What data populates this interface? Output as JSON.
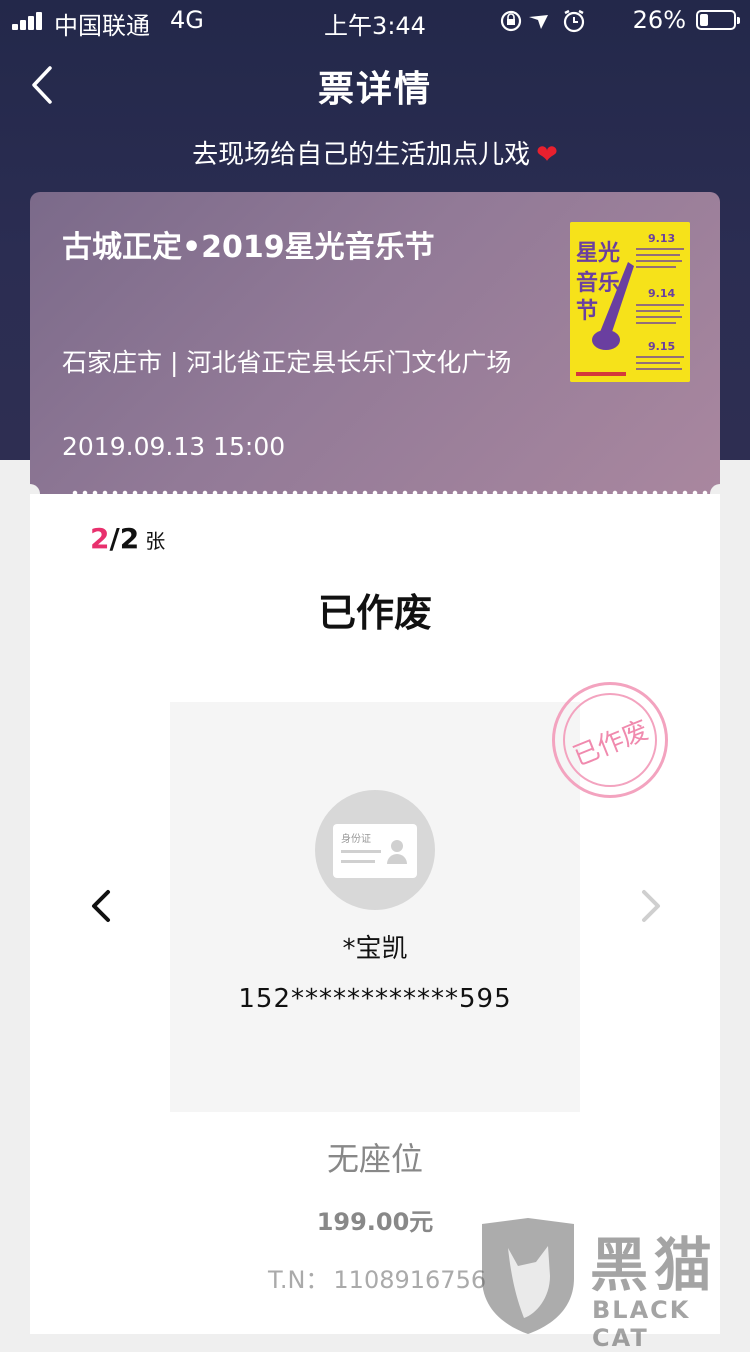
{
  "status_bar": {
    "carrier": "中国联通",
    "network": "4G",
    "time": "上午3:44",
    "battery_percent": "26%",
    "battery_level": 0.26
  },
  "header": {
    "title": "票详情",
    "slogan": "去现场给自己的生活加点儿戏",
    "slogan_icon": "heart-icon",
    "heart_symbol": "❤"
  },
  "event": {
    "title": "古城正定•2019星光音乐节",
    "venue": "石家庄市 | 河北省正定县长乐门文化广场",
    "datetime": "2019.09.13 15:00",
    "poster": {
      "title": "星光音乐节",
      "dates": [
        "9.13",
        "9.14",
        "9.15"
      ]
    }
  },
  "ticket": {
    "current": "2",
    "total": "/2",
    "unit": "张",
    "status": "已作废",
    "stamp": "已作废",
    "id_card_label": "身份证",
    "holder_name": "*宝凯",
    "holder_id": "152************595",
    "seat": "无座位",
    "price": "199.00元",
    "tn_label": "T.N：",
    "tn_value": "1108916756"
  },
  "watermark": {
    "cn": "黑猫",
    "en": "BLACK CAT"
  },
  "colors": {
    "header_bg": "#23284a",
    "accent_pink": "#e8306d",
    "stamp_pink": "#f08aae"
  }
}
